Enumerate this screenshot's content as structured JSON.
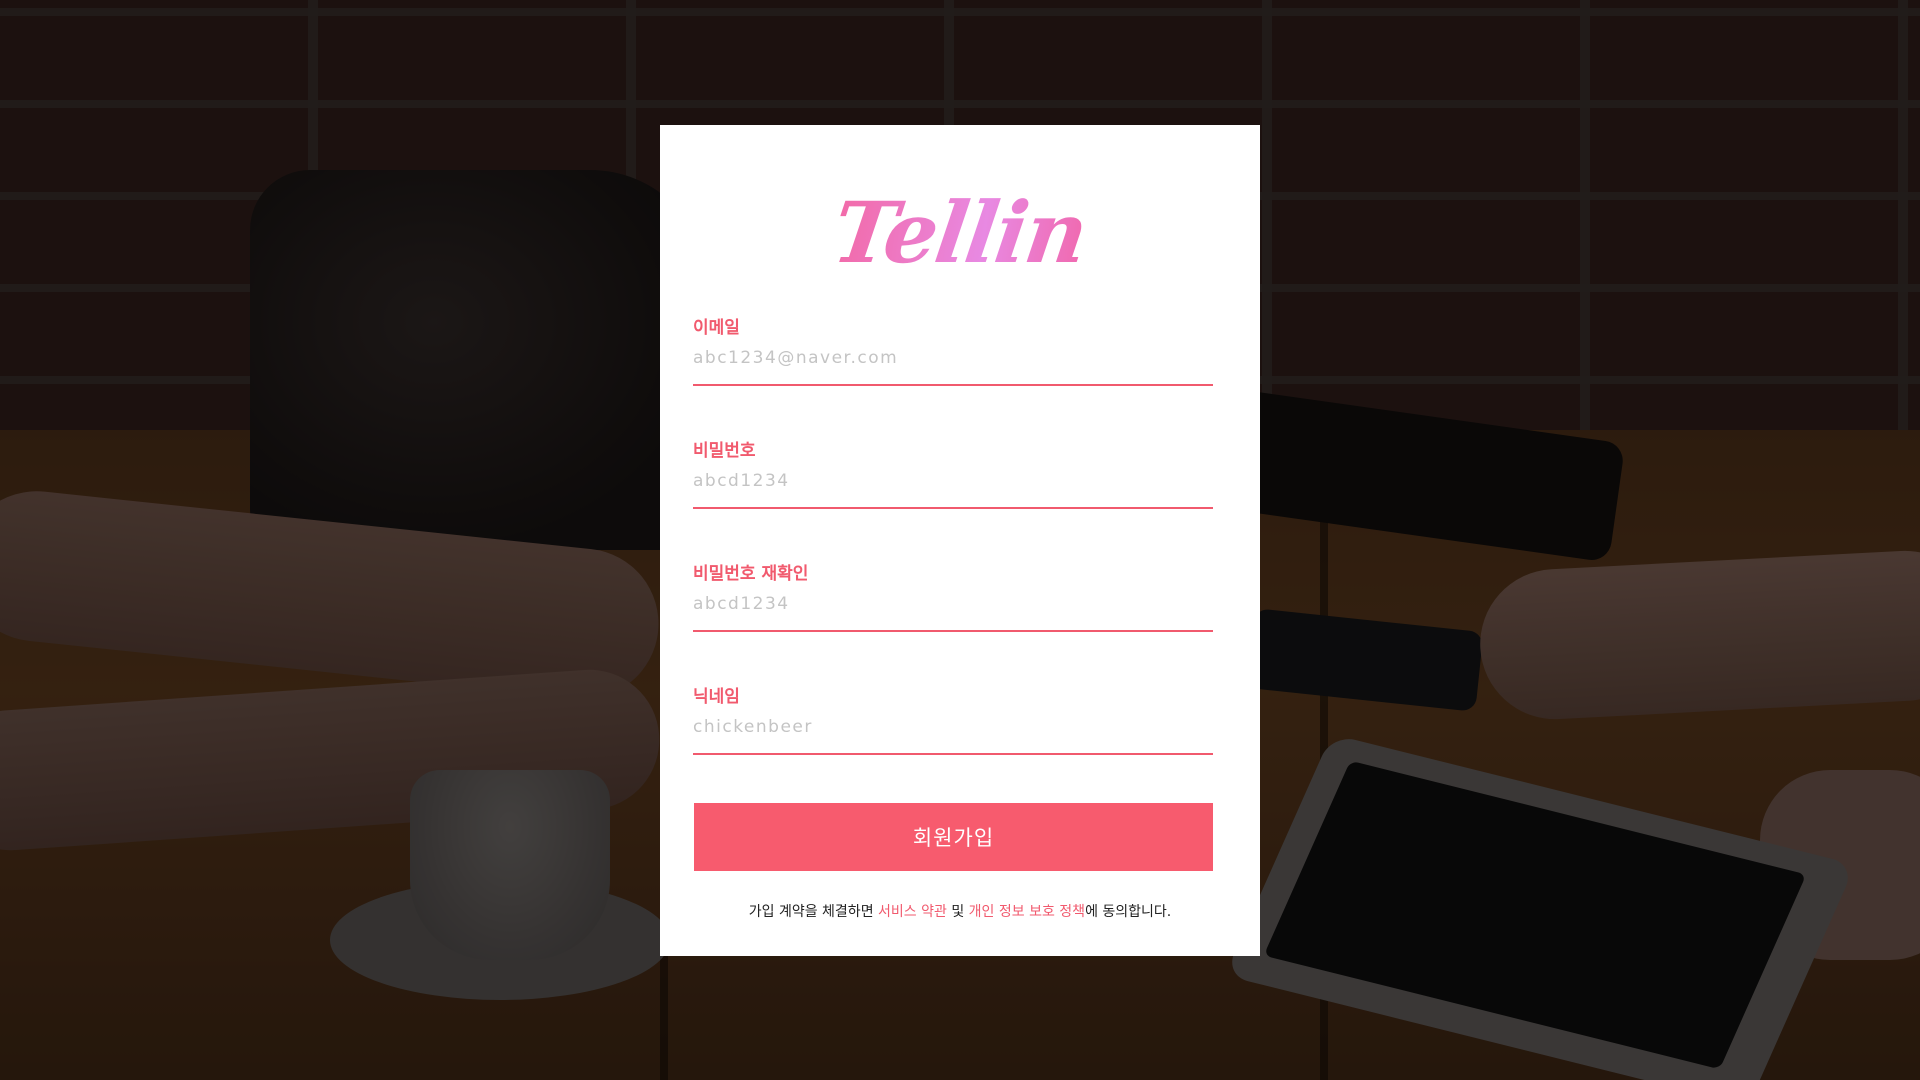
{
  "app": {
    "logo_text": "Tellin"
  },
  "form": {
    "email": {
      "label": "이메일",
      "placeholder": "abc1234@naver.com"
    },
    "password": {
      "label": "비밀번호",
      "placeholder": "abcd1234"
    },
    "password_confirm": {
      "label": "비밀번호 재확인",
      "placeholder": "abcd1234"
    },
    "nickname": {
      "label": "닉네임",
      "placeholder": "chickenbeer"
    },
    "submit_label": "회원가입"
  },
  "terms": {
    "prefix": "가입 계약을 체결하면 ",
    "terms_link": "서비스 약관",
    "conjunction": " 및 ",
    "privacy_link": "개인 정보 보호 정책",
    "suffix": "에 동의합니다."
  },
  "colors": {
    "accent": "#f15a6e",
    "button": "#f75b6e",
    "logo_pink": "#ef74c4",
    "card_background": "#ffffff"
  }
}
